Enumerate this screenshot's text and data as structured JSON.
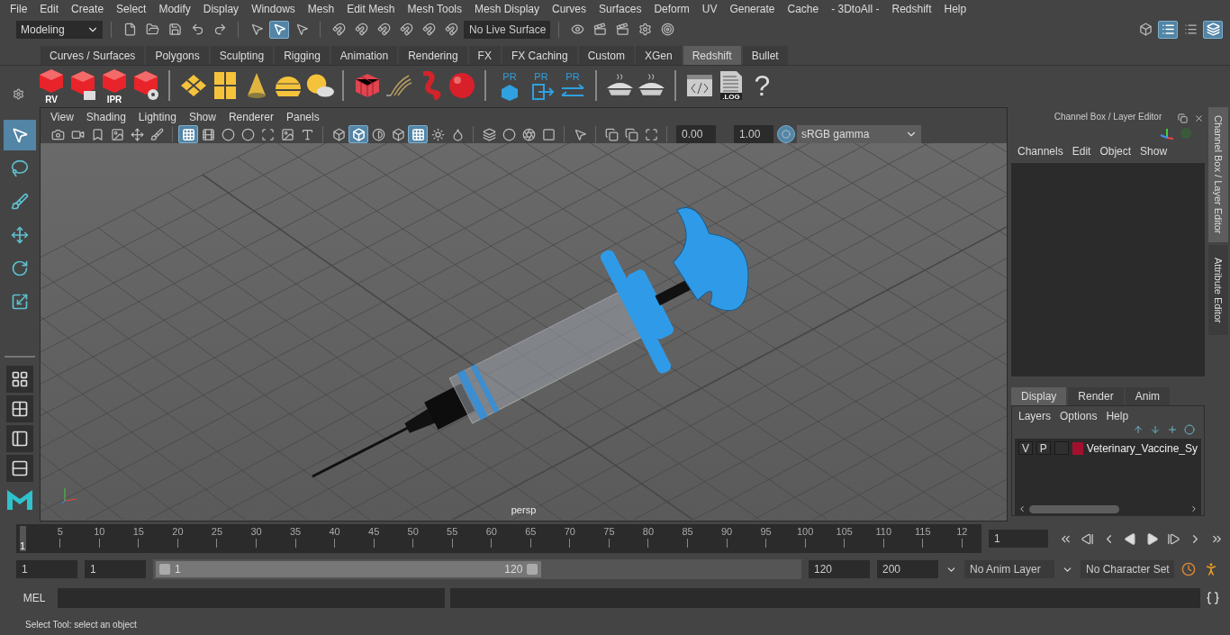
{
  "menu_bar": [
    "File",
    "Edit",
    "Create",
    "Select",
    "Modify",
    "Display",
    "Windows",
    "Mesh",
    "Edit Mesh",
    "Mesh Tools",
    "Mesh Display",
    "Curves",
    "Surfaces",
    "Deform",
    "UV",
    "Generate",
    "Cache",
    "- 3DtoAll -",
    "Redshift",
    "Help"
  ],
  "status_line": {
    "mode": "Modeling",
    "live_surface": "No Live Surface",
    "tools": [
      [
        {
          "kind": "file",
          "on": false
        },
        {
          "kind": "folder",
          "on": false
        },
        {
          "kind": "save",
          "on": false
        },
        {
          "kind": "undo",
          "on": false
        },
        {
          "kind": "redo",
          "on": false
        }
      ],
      [
        {
          "kind": "pointer",
          "on": false
        },
        {
          "kind": "pointer",
          "on": true
        },
        {
          "kind": "pointer",
          "on": false
        }
      ],
      [
        {
          "kind": "magnet",
          "on": false
        },
        {
          "kind": "magnet",
          "on": false
        },
        {
          "kind": "magnet",
          "on": false
        },
        {
          "kind": "magnet",
          "on": false
        },
        {
          "kind": "magnet",
          "on": false
        },
        {
          "kind": "magnet",
          "on": false
        }
      ]
    ],
    "render_tools": [
      [
        {
          "kind": "eye",
          "on": false
        },
        {
          "kind": "clapper",
          "on": false
        },
        {
          "kind": "clapper",
          "on": false
        },
        {
          "kind": "settings",
          "on": false
        },
        {
          "kind": "target",
          "on": false
        }
      ]
    ],
    "panel_tools": [
      [
        {
          "kind": "cube",
          "on": false
        },
        {
          "kind": "list",
          "on": true
        },
        {
          "kind": "list",
          "on": false
        },
        {
          "kind": "layers",
          "on": true
        }
      ]
    ]
  },
  "shelf": {
    "tabs": [
      {
        "label": "Curves / Surfaces",
        "selected": false
      },
      {
        "label": "Polygons",
        "selected": false
      },
      {
        "label": "Sculpting",
        "selected": false
      },
      {
        "label": "Rigging",
        "selected": false
      },
      {
        "label": "Animation",
        "selected": false
      },
      {
        "label": "Rendering",
        "selected": false
      },
      {
        "label": "FX",
        "selected": false
      },
      {
        "label": "FX Caching",
        "selected": false
      },
      {
        "label": "Custom",
        "selected": false
      },
      {
        "label": "XGen",
        "selected": false
      },
      {
        "label": "Redshift",
        "selected": true
      },
      {
        "label": "Bullet",
        "selected": false
      }
    ],
    "groups": [
      [
        {
          "kind": "rs-cube",
          "text": "RV"
        },
        {
          "kind": "rs-cube-clapper"
        },
        {
          "kind": "rs-cube",
          "text": "IPR"
        },
        {
          "kind": "rs-cube-gear"
        }
      ],
      [
        {
          "kind": "diamonds"
        },
        {
          "kind": "panels"
        },
        {
          "kind": "cone"
        },
        {
          "kind": "dome"
        },
        {
          "kind": "sun-cloud"
        }
      ],
      [
        {
          "kind": "cubes"
        },
        {
          "kind": "strands"
        },
        {
          "kind": "tube"
        },
        {
          "kind": "sphere"
        }
      ],
      [
        {
          "kind": "pr-box",
          "text": "PR"
        },
        {
          "kind": "pr-export",
          "text": "PR"
        },
        {
          "kind": "pr-swap",
          "text": "PR"
        }
      ],
      [
        {
          "kind": "pie"
        },
        {
          "kind": "pie"
        }
      ],
      [
        {
          "kind": "code"
        },
        {
          "kind": "log",
          "text": ".LOG"
        },
        {
          "kind": "help",
          "text": "?"
        }
      ]
    ]
  },
  "toolbox": {
    "tools": [
      {
        "kind": "select",
        "selected": true
      },
      {
        "kind": "lasso",
        "selected": false
      },
      {
        "kind": "paint",
        "selected": false
      },
      {
        "kind": "move",
        "selected": false
      },
      {
        "kind": "rotate",
        "selected": false
      },
      {
        "kind": "scale",
        "selected": false
      }
    ],
    "layouts": [
      {
        "kind": "single"
      },
      {
        "kind": "quad"
      },
      {
        "kind": "split"
      },
      {
        "kind": "stack"
      }
    ]
  },
  "viewport": {
    "menu": [
      "View",
      "Shading",
      "Lighting",
      "Show",
      "Renderer",
      "Panels"
    ],
    "tools": [
      [
        {
          "kind": "camera",
          "on": false
        },
        {
          "kind": "video",
          "on": false
        },
        {
          "kind": "bookmark",
          "on": false
        },
        {
          "kind": "image",
          "on": false
        },
        {
          "kind": "move",
          "on": false
        },
        {
          "kind": "brush",
          "on": false
        }
      ],
      [
        {
          "kind": "grid",
          "on": true
        },
        {
          "kind": "film",
          "on": false
        },
        {
          "kind": "circle",
          "on": false
        },
        {
          "kind": "circle",
          "on": false
        },
        {
          "kind": "scan",
          "on": false
        },
        {
          "kind": "image",
          "on": false
        },
        {
          "kind": "type",
          "on": false
        }
      ],
      [
        {
          "kind": "box",
          "on": false
        },
        {
          "kind": "box",
          "on": true
        },
        {
          "kind": "contrast",
          "on": false
        },
        {
          "kind": "box",
          "on": false
        },
        {
          "kind": "grid",
          "on": true
        },
        {
          "kind": "sun",
          "on": false
        },
        {
          "kind": "droplet",
          "on": false
        }
      ],
      [
        {
          "kind": "layers",
          "on": false
        },
        {
          "kind": "circle",
          "on": false
        },
        {
          "kind": "aperture",
          "on": false
        },
        {
          "kind": "square",
          "on": false
        }
      ],
      [
        {
          "kind": "pointer",
          "on": false
        }
      ],
      [
        {
          "kind": "copy",
          "on": false
        },
        {
          "kind": "copy",
          "on": false
        },
        {
          "kind": "maximize",
          "on": false
        }
      ]
    ],
    "exposure": "0.00",
    "gamma": "1.00",
    "color_management_on": true,
    "color_space": "sRGB gamma",
    "camera": "persp"
  },
  "channel_box": {
    "title": "Channel Box / Layer Editor",
    "menu": [
      "Channels",
      "Edit",
      "Object",
      "Show"
    ]
  },
  "layer_editor": {
    "tabs": [
      {
        "label": "Display",
        "selected": true
      },
      {
        "label": "Render",
        "selected": false
      },
      {
        "label": "Anim",
        "selected": false
      }
    ],
    "menu": [
      "Layers",
      "Options",
      "Help"
    ],
    "layers": [
      {
        "visible": "V",
        "playback": "P",
        "color": "#a3102e",
        "name": "Veterinary_Vaccine_Sy"
      }
    ]
  },
  "side_tabs": [
    {
      "label": "Channel Box / Layer Editor",
      "selected": true
    },
    {
      "label": "Attribute Editor",
      "selected": false
    }
  ],
  "timeline": {
    "ticks": [
      "5",
      "10",
      "15",
      "20",
      "25",
      "30",
      "35",
      "40",
      "45",
      "50",
      "55",
      "60",
      "65",
      "70",
      "75",
      "80",
      "85",
      "90",
      "95",
      "100",
      "105",
      "110",
      "115",
      "12"
    ],
    "start_marker": "1",
    "level": 0,
    "current_frame": "1"
  },
  "range": {
    "start": "1",
    "playback_start": "1",
    "slider_start": "1",
    "slider_end": "120",
    "playback_end": "120",
    "end": "200",
    "level": 0.6,
    "anim_layer": "No Anim Layer",
    "character_set": "No Character Set"
  },
  "command_line": {
    "language": "MEL"
  },
  "help_line": "Select Tool: select an object"
}
